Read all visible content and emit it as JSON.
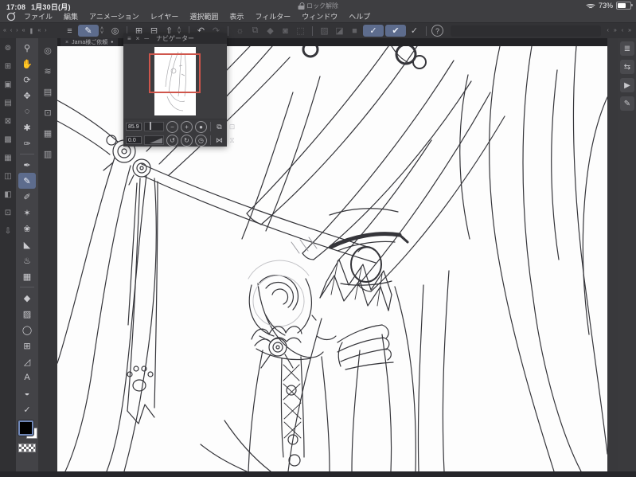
{
  "colors": {
    "accent": "#5d6c8d",
    "navigator_frame_red": "#cf564c",
    "canvas_bg": "#fdfdfd"
  },
  "status_bar": {
    "time": "17:08",
    "date": "1月30日(月)",
    "lock_label": "ロック解除",
    "battery": "73%"
  },
  "menu_bar": {
    "items": [
      {
        "name": "menu-file",
        "label": "ファイル"
      },
      {
        "name": "menu-edit",
        "label": "編集"
      },
      {
        "name": "menu-animation",
        "label": "アニメーション"
      },
      {
        "name": "menu-layer",
        "label": "レイヤー"
      },
      {
        "name": "menu-selection",
        "label": "選択範囲"
      },
      {
        "name": "menu-view",
        "label": "表示"
      },
      {
        "name": "menu-filter",
        "label": "フィルター"
      },
      {
        "name": "menu-window",
        "label": "ウィンドウ"
      },
      {
        "name": "menu-help",
        "label": "ヘルプ"
      }
    ]
  },
  "collapse_arrows_left": [
    "«",
    "‹",
    "›",
    "«",
    "❚",
    "«",
    "›"
  ],
  "collapse_arrows_right": [
    "‹",
    "»",
    "‹",
    "»"
  ],
  "command_bar": {
    "items": [
      {
        "name": "main-menu-icon",
        "glyph": "≡",
        "state": "normal"
      },
      {
        "name": "current-tool-button",
        "glyph": "✎",
        "state": "active"
      },
      {
        "name": "tool-switch-chevrons",
        "glyph": "˄˅",
        "state": "chev"
      },
      {
        "name": "view-mode-icon",
        "glyph": "◎",
        "state": "normal"
      },
      {
        "state": "divider"
      },
      {
        "name": "new-canvas-icon",
        "glyph": "⊞",
        "state": "normal"
      },
      {
        "name": "open-file-icon",
        "glyph": "⊟",
        "state": "normal"
      },
      {
        "name": "export-icon",
        "glyph": "⇧",
        "state": "normal"
      },
      {
        "name": "export-chevrons",
        "glyph": "˄˅",
        "state": "chev"
      },
      {
        "state": "divider"
      },
      {
        "name": "undo-icon",
        "glyph": "↶",
        "state": "normal"
      },
      {
        "name": "redo-icon",
        "glyph": "↷",
        "state": "disabled"
      },
      {
        "state": "divider"
      },
      {
        "name": "brightness-icon",
        "glyph": "☼",
        "state": "disabled"
      },
      {
        "name": "duplicate-layer-icon",
        "glyph": "⧉",
        "state": "disabled"
      },
      {
        "name": "rotate-object-icon",
        "glyph": "◆",
        "state": "disabled"
      },
      {
        "name": "zoom-image-icon",
        "glyph": "◙",
        "state": "disabled"
      },
      {
        "name": "transform-icon",
        "glyph": "⬚",
        "state": "disabled"
      },
      {
        "state": "divider"
      },
      {
        "name": "deselect-icon",
        "glyph": "▨",
        "state": "disabled"
      },
      {
        "name": "invert-selection-icon",
        "glyph": "◪",
        "state": "disabled"
      },
      {
        "name": "selection-fill-icon",
        "glyph": "■",
        "state": "disabled"
      },
      {
        "name": "snap-to-ruler-icon",
        "glyph": "✓",
        "state": "active"
      },
      {
        "name": "snap-to-special-ruler-icon",
        "glyph": "✔",
        "state": "active"
      },
      {
        "name": "snap-to-grid-icon",
        "glyph": "✓",
        "state": "normal"
      },
      {
        "state": "divider"
      },
      {
        "name": "help-icon",
        "glyph": "?",
        "state": "circled"
      }
    ]
  },
  "tab_bar": {
    "close_glyph": "×",
    "title": "Jama様ご依頼",
    "modified_dot": "●"
  },
  "left_panel_icons": [
    {
      "name": "magnifier-panel-icon",
      "glyph": "⊚"
    },
    {
      "name": "workspace-grid-panel-icon",
      "glyph": "⊞"
    },
    {
      "name": "page-panel-icon",
      "glyph": "▣"
    },
    {
      "name": "list-panel-icon",
      "glyph": "▤"
    },
    {
      "name": "close-box-panel-icon",
      "glyph": "⊠"
    },
    {
      "name": "tone-panel-icon",
      "glyph": "▩"
    },
    {
      "name": "material-panel-icon",
      "glyph": "▦"
    },
    {
      "name": "frame-panel-icon",
      "glyph": "◫"
    },
    {
      "name": "edit-panel-icon",
      "glyph": "◧"
    },
    {
      "name": "star-panel-icon",
      "glyph": "⊡"
    },
    {
      "name": "download-panel-icon",
      "glyph": "⇩"
    }
  ],
  "toolbar": {
    "tools": [
      {
        "name": "zoom-tool",
        "glyph": "⚲",
        "state": "normal"
      },
      {
        "name": "hand-tool",
        "glyph": "✋",
        "state": "normal"
      },
      {
        "name": "rotate-view-tool",
        "glyph": "⟳",
        "state": "normal"
      },
      {
        "name": "move-tool",
        "glyph": "✥",
        "state": "normal"
      },
      {
        "name": "lasso-tool",
        "glyph": "◌",
        "state": "normal"
      },
      {
        "name": "auto-select-tool",
        "glyph": "✱",
        "state": "normal"
      },
      {
        "name": "eyedropper-tool",
        "glyph": "✑",
        "state": "normal"
      },
      {
        "state": "divider"
      },
      {
        "name": "pen-tool",
        "glyph": "✒",
        "state": "normal"
      },
      {
        "name": "pencil-tool",
        "glyph": "✎",
        "state": "selected"
      },
      {
        "name": "brush-tool",
        "glyph": "✐",
        "state": "normal"
      },
      {
        "name": "airbrush-tool",
        "glyph": "✶",
        "state": "normal"
      },
      {
        "name": "decoration-tool",
        "glyph": "❀",
        "state": "normal"
      },
      {
        "name": "eraser-tool",
        "glyph": "◣",
        "state": "normal"
      },
      {
        "name": "blend-tool",
        "glyph": "♨",
        "state": "normal"
      },
      {
        "name": "liquify-tool",
        "glyph": "▦",
        "state": "normal"
      },
      {
        "state": "divider"
      },
      {
        "name": "fill-tool",
        "glyph": "◆",
        "state": "normal"
      },
      {
        "name": "gradient-tool",
        "glyph": "▨",
        "state": "normal"
      },
      {
        "name": "figure-tool",
        "glyph": "◯",
        "state": "normal"
      },
      {
        "name": "frame-border-tool",
        "glyph": "⊞",
        "state": "normal"
      },
      {
        "name": "polyline-tool",
        "glyph": "◿",
        "state": "normal"
      },
      {
        "name": "text-tool",
        "glyph": "A",
        "state": "normal"
      },
      {
        "name": "balloon-tool",
        "glyph": "◒",
        "state": "normal"
      },
      {
        "name": "correct-line-tool",
        "glyph": "✓",
        "state": "normal"
      }
    ]
  },
  "sub_panel_icons": [
    {
      "name": "quick-access-icon",
      "glyph": "◎"
    },
    {
      "name": "sub-tool-icon",
      "glyph": "≋"
    },
    {
      "name": "tool-property-icon",
      "glyph": "▤"
    },
    {
      "name": "brush-size-icon",
      "glyph": "⊡"
    },
    {
      "name": "color-set-icon",
      "glyph": "▦"
    },
    {
      "name": "color-slider-icon",
      "glyph": "▥"
    }
  ],
  "right_panel_icons": [
    {
      "name": "layer-color-panel-icon",
      "glyph": "≣"
    },
    {
      "name": "timeline-panel-icon",
      "glyph": "⇆"
    },
    {
      "name": "animation-panel-icon",
      "glyph": "▶"
    },
    {
      "name": "layer-edit-panel-icon",
      "glyph": "✎"
    }
  ],
  "navigator": {
    "title": "ナビゲーター",
    "menu_glyph": "≡",
    "close_glyph": "×",
    "minimize_glyph": "─",
    "zoom_value": "85.9",
    "rotation_value": "0.0",
    "zoom_out_glyph": "−",
    "zoom_in_glyph": "+",
    "zoom_reset_glyph": "●",
    "fit_screen_glyph": "⧉",
    "fit_window_glyph": "⊡",
    "rotate_left_glyph": "↺",
    "rotate_right_glyph": "↻",
    "reset_rotation_glyph": "◷",
    "flip_horizontal_glyph": "⋈",
    "reset_view_glyph": "⧖"
  },
  "color_swatches": {
    "foreground": "#000000",
    "background": "#ffffff"
  }
}
